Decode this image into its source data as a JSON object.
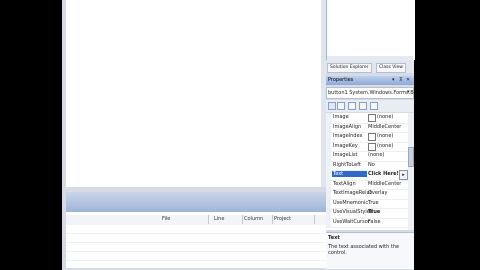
{
  "solution_tabs": [
    "Solution Explorer",
    "Class View"
  ],
  "properties": {
    "title": "Properties",
    "title_buttons": [
      "▾",
      "⊼",
      "✕"
    ],
    "object_selector": "button1  System.Windows.Forms.B",
    "rows": [
      {
        "name": "Image",
        "value": "(none)",
        "swatch": true
      },
      {
        "name": "ImageAlign",
        "value": "MiddleCenter",
        "swatch": false
      },
      {
        "name": "ImageIndex",
        "value": "(none)",
        "swatch": true
      },
      {
        "name": "ImageKey",
        "value": "(none)",
        "swatch": true
      },
      {
        "name": "ImageList",
        "value": "(none)",
        "swatch": false
      },
      {
        "name": "RightToLeft",
        "value": "No",
        "swatch": false
      },
      {
        "name": "Text",
        "value": "Click Here!",
        "swatch": false,
        "selected": true
      },
      {
        "name": "TextAlign",
        "value": "MiddleCenter",
        "swatch": false
      },
      {
        "name": "TextImageRelat",
        "value": "Overlay",
        "swatch": false
      },
      {
        "name": "UseMnemonic",
        "value": "True",
        "swatch": false
      },
      {
        "name": "UseVisualStyleB",
        "value": "True",
        "swatch": false,
        "bold": true
      },
      {
        "name": "UseWaitCursor",
        "value": "False",
        "swatch": false
      }
    ],
    "description_title": "Text",
    "description_text": "The text associated with the control."
  },
  "error_list": {
    "columns": [
      "File",
      "Line",
      "Column",
      "Project"
    ]
  },
  "colors": {
    "selection": "#3169c6",
    "panel_header": "#9fb4d6"
  }
}
